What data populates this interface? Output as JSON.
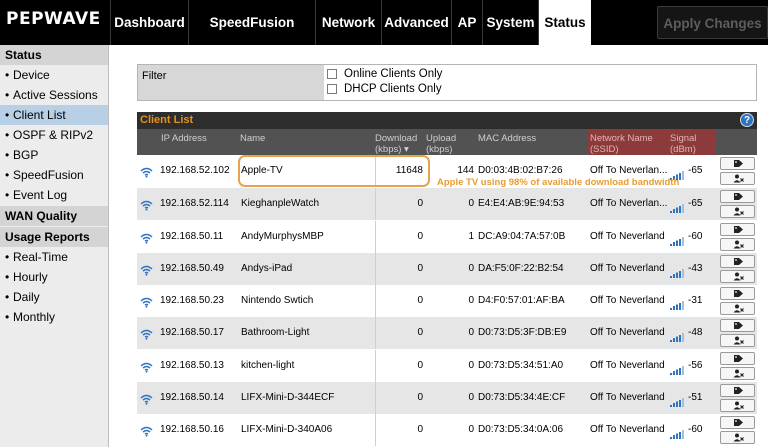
{
  "brand": "PEPWAVE",
  "nav": [
    "Dashboard",
    "SpeedFusion Cloud",
    "Network",
    "Advanced",
    "AP",
    "System",
    "Status"
  ],
  "nav_active": "Status",
  "apply_label": "Apply Changes",
  "sidebar": {
    "status_title": "Status",
    "status_items": [
      "Device",
      "Active Sessions",
      "Client List",
      "OSPF & RIPv2",
      "BGP",
      "SpeedFusion",
      "Event Log"
    ],
    "active_item": "Client List",
    "wan_title": "WAN Quality",
    "usage_title": "Usage Reports",
    "usage_items": [
      "Real-Time",
      "Hourly",
      "Daily",
      "Monthly"
    ]
  },
  "filter": {
    "label": "Filter",
    "options": [
      "Online Clients Only",
      "DHCP Clients Only"
    ]
  },
  "client_list": {
    "title": "Client List",
    "help": "?",
    "headers": {
      "ip": "IP Address",
      "name": "Name",
      "download": "Download",
      "download_unit": "(kbps) ▾",
      "upload": "Upload",
      "upload_unit": "(kbps)",
      "mac": "MAC Address",
      "network": "Network Name",
      "network_sub": "(SSID)",
      "signal": "Signal",
      "signal_unit": "(dBm)"
    },
    "rows": [
      {
        "ip": "192.168.52.102",
        "name": "Apple-TV",
        "download": "11648",
        "upload": "144",
        "mac": "D0:03:4B:02:B7:26",
        "mac_grey": false,
        "ssid": "Off To Neverlan...",
        "signal": "-65"
      },
      {
        "ip": "192.168.52.114",
        "name": "KieghanpleWatch",
        "download": "0",
        "upload": "0",
        "mac": "E4:E4:AB:9E:94:53",
        "mac_grey": false,
        "ssid": "Off To Neverlan...",
        "signal": "-65"
      },
      {
        "ip": "192.168.50.11",
        "name": "AndyMurphysMBP",
        "download": "0",
        "upload": "1",
        "mac": "DC:A9:04:7A:57:0B",
        "mac_grey": false,
        "ssid": "Off To Neverland",
        "signal": "-60"
      },
      {
        "ip": "192.168.50.49",
        "name": "Andys-iPad",
        "download": "0",
        "upload": "0",
        "mac": "DA:F5:0F:22:B2:54",
        "mac_grey": true,
        "ssid": "Off To Neverland",
        "signal": "-43"
      },
      {
        "ip": "192.168.50.23",
        "name": "Nintendo Swtich",
        "download": "0",
        "upload": "0",
        "mac": "D4:F0:57:01:AF:BA",
        "mac_grey": false,
        "ssid": "Off To Neverland",
        "signal": "-31"
      },
      {
        "ip": "192.168.50.17",
        "name": "Bathroom-Light",
        "download": "0",
        "upload": "0",
        "mac": "D0:73:D5:3F:DB:E9",
        "mac_grey": false,
        "ssid": "Off To Neverland",
        "signal": "-48"
      },
      {
        "ip": "192.168.50.13",
        "name": "kitchen-light",
        "download": "0",
        "upload": "0",
        "mac": "D0:73:D5:34:51:A0",
        "mac_grey": false,
        "ssid": "Off To Neverland",
        "signal": "-56"
      },
      {
        "ip": "192.168.50.14",
        "name": "LIFX-Mini-D-344ECF",
        "download": "0",
        "upload": "0",
        "mac": "D0:73:D5:34:4E:CF",
        "mac_grey": false,
        "ssid": "Off To Neverland",
        "signal": "-51"
      },
      {
        "ip": "192.168.50.16",
        "name": "LIFX-Mini-D-340A06",
        "download": "0",
        "upload": "0",
        "mac": "D0:73:D5:34:0A:06",
        "mac_grey": false,
        "ssid": "Off To Neverland",
        "signal": "-60"
      }
    ],
    "annotation": "Apple TV using 98% of available download bandwidth"
  },
  "colors": {
    "accent_orange": "#e89c30",
    "wifi_blue": "#2f74c0",
    "sidebar_active": "#b7d0e6",
    "header_red": "#8c3a3a"
  },
  "icons": {
    "row_wifi": "wifi-icon",
    "signal": "signal-bars-icon",
    "tag": "tag-icon",
    "block_user": "block-user-icon"
  }
}
